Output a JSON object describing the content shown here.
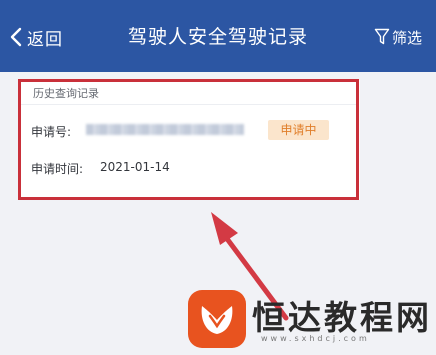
{
  "nav": {
    "back_label": "返回",
    "title": "驾驶人安全驾驶记录",
    "filter_label": "筛选"
  },
  "record": {
    "section_title": "历史查询记录",
    "application_no_label": "申请号:",
    "application_no_value": "masked",
    "status": "申请中",
    "application_time_label": "申请时间:",
    "application_time_value": "2021-01-14"
  },
  "watermark": {
    "name": "恒达教程网",
    "domain": "www.sxhdcj.com"
  },
  "colors": {
    "nav_bar": "#2c56a3",
    "page_background": "#f1f2f6",
    "status_badge_bg": "#fbe5cc",
    "status_badge_text": "#e07f2b",
    "annotation_red": "#d33a44",
    "logo_orange": "#e8531f"
  },
  "icons": {
    "back": "chevron-left-icon",
    "filter": "funnel-icon",
    "annotation": "arrow-up-left-icon"
  }
}
